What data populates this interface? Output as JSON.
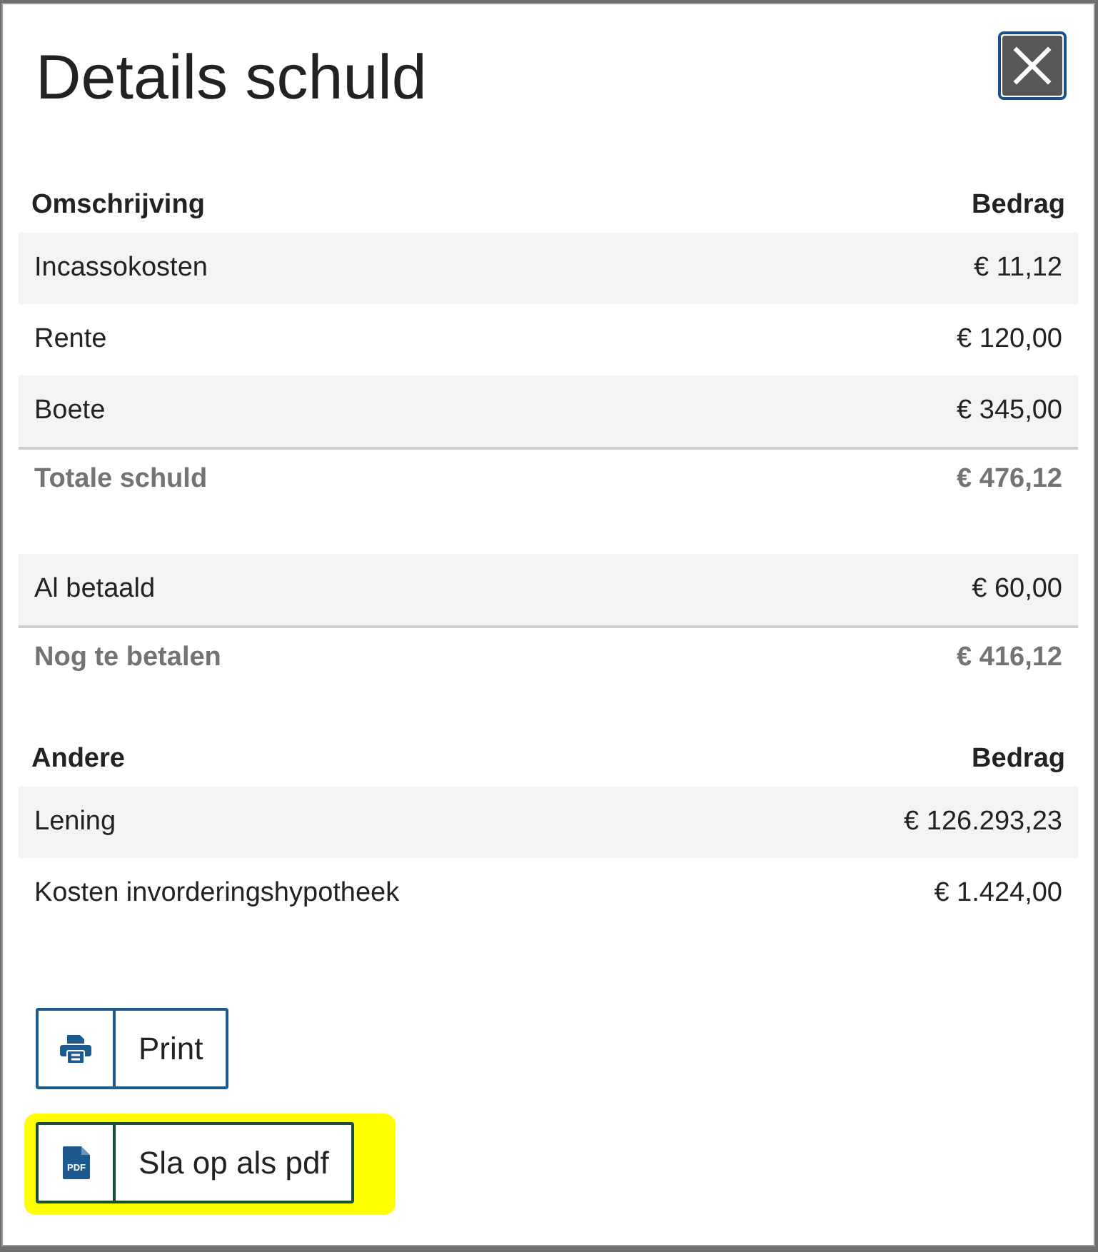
{
  "dialog": {
    "title": "Details schuld"
  },
  "sections": [
    {
      "header": {
        "label": "Omschrijving",
        "amount": "Bedrag"
      },
      "rows": [
        {
          "kind": "item",
          "label": "Incassokosten",
          "amount": "€ 11,12"
        },
        {
          "kind": "item",
          "label": "Rente",
          "amount": "€ 120,00"
        },
        {
          "kind": "item",
          "label": "Boete",
          "amount": "€ 345,00"
        },
        {
          "kind": "total",
          "label": "Totale schuld",
          "amount": "€ 476,12"
        }
      ]
    },
    {
      "rows": [
        {
          "kind": "item",
          "label": "Al betaald",
          "amount": "€ 60,00"
        },
        {
          "kind": "total",
          "label": "Nog te betalen",
          "amount": "€ 416,12"
        }
      ]
    },
    {
      "header": {
        "label": "Andere",
        "amount": "Bedrag"
      },
      "rows": [
        {
          "kind": "item",
          "label": "Lening",
          "amount": "€ 126.293,23"
        },
        {
          "kind": "item",
          "label": "Kosten invorderingshypotheek",
          "amount": "€ 1.424,00"
        }
      ]
    }
  ],
  "buttons": [
    {
      "kind": "print",
      "label": "Print",
      "highlighted": false
    },
    {
      "kind": "pdf",
      "label": "Sla op als pdf",
      "icon_text": "PDF",
      "highlighted": true
    }
  ]
}
